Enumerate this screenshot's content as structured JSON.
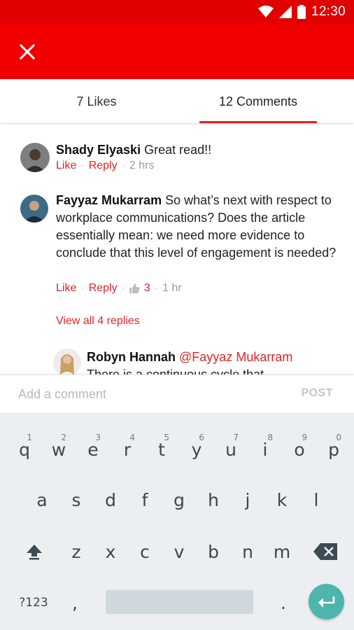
{
  "status_bar": {
    "time": "12:30"
  },
  "colors": {
    "brand": "#f20000",
    "accent": "#e52222",
    "keyboard_bg": "#eceff1",
    "enter_key": "#4db6ac"
  },
  "tabs": [
    {
      "label": "7 Likes",
      "active": false
    },
    {
      "label": "12 Comments",
      "active": true
    }
  ],
  "comments": [
    {
      "author": "Shady Elyaski",
      "text": "Great read!!",
      "like_label": "Like",
      "reply_label": "Reply",
      "time": "2 hrs"
    },
    {
      "author": "Fayyaz Mukarram",
      "text": "So what’s next with respect to workplace communications? Does the article essentially mean: we need more evidence to conclude that this level of engagement is needed?",
      "like_label": "Like",
      "reply_label": "Reply",
      "likes": "3",
      "time": "1 hr",
      "view_replies": "View all 4 replies"
    }
  ],
  "reply": {
    "author": "Robyn Hannah",
    "mention": "@Fayyaz Mukarram",
    "text": "There is a continuous cycle that..."
  },
  "composer": {
    "placeholder": "Add a comment",
    "post_label": "POST"
  },
  "keyboard": {
    "row1": [
      "q",
      "w",
      "e",
      "r",
      "t",
      "y",
      "u",
      "i",
      "o",
      "p"
    ],
    "row1_hints": [
      "1",
      "2",
      "3",
      "4",
      "5",
      "6",
      "7",
      "8",
      "9",
      "0"
    ],
    "row2": [
      "a",
      "s",
      "d",
      "f",
      "g",
      "h",
      "j",
      "k",
      "l"
    ],
    "row3": [
      "z",
      "x",
      "c",
      "v",
      "b",
      "n",
      "m"
    ],
    "symbols_label": "?123",
    "comma": ",",
    "period": "."
  }
}
